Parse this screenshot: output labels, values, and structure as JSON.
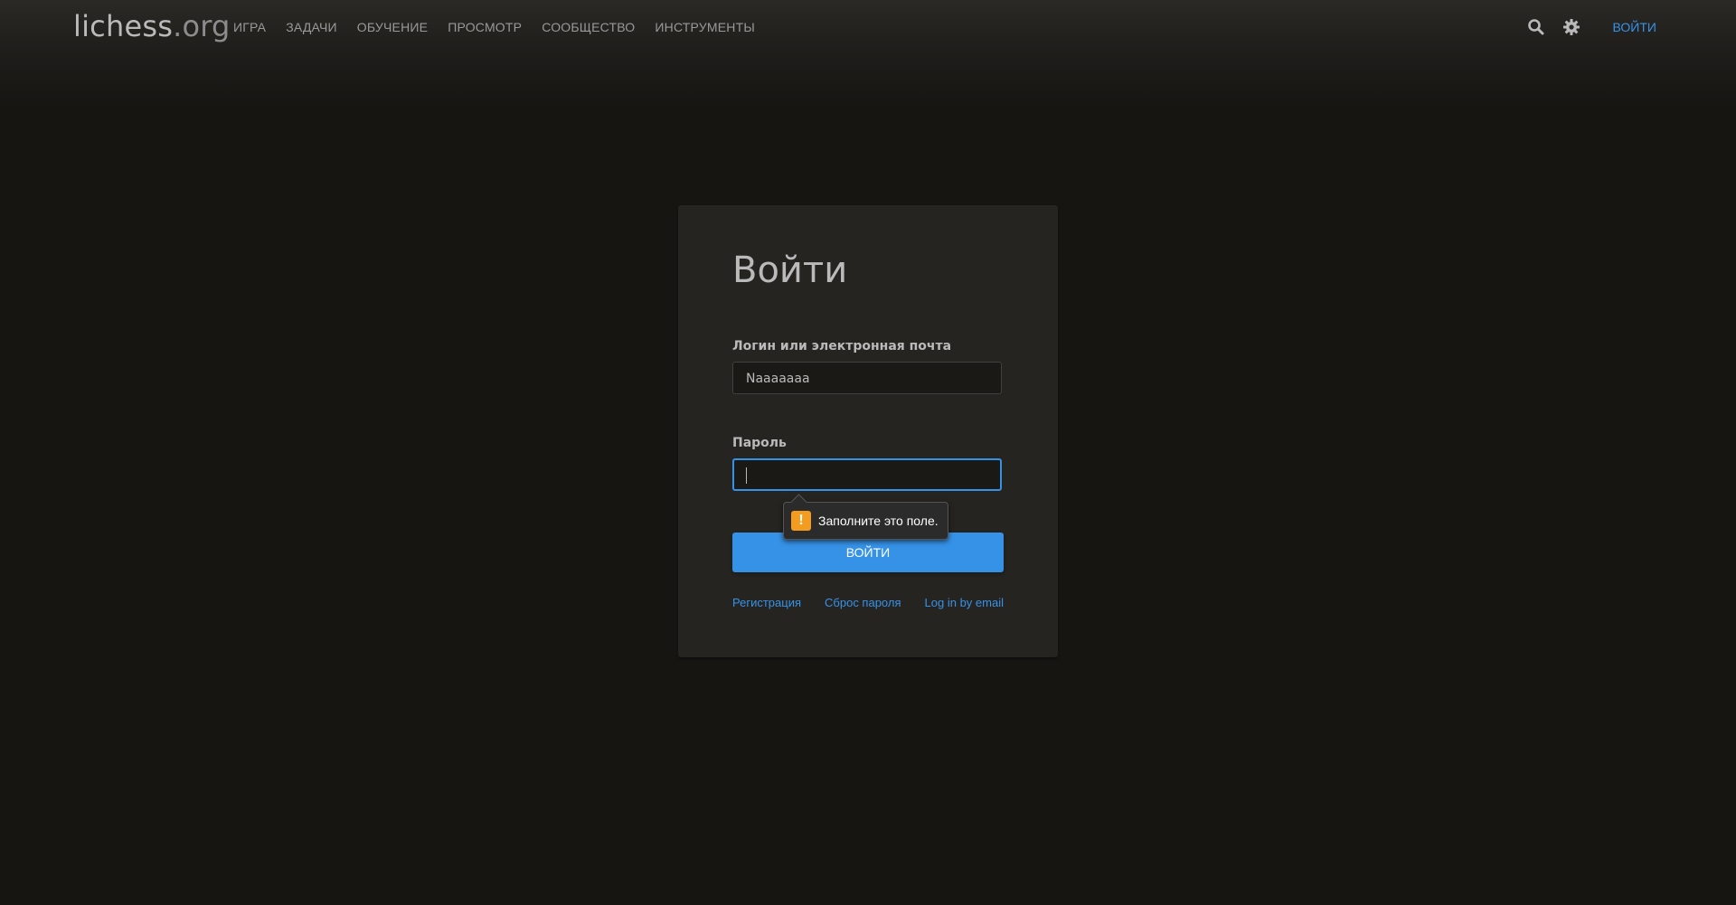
{
  "header": {
    "logo_main": "lichess",
    "logo_tld": ".org",
    "nav": [
      "ИГРА",
      "ЗАДАЧИ",
      "ОБУЧЕНИЕ",
      "ПРОСМОТР",
      "СООБЩЕСТВО",
      "ИНСТРУМЕНТЫ"
    ],
    "signin_label": "ВОЙТИ",
    "icons": [
      "search-icon",
      "gear-icon"
    ]
  },
  "login": {
    "title": "Войти",
    "username_label": "Логин или электронная почта",
    "username_value": "Naaaaaaa",
    "password_label": "Пароль",
    "password_value": "",
    "submit_label": "ВОЙТИ",
    "links": [
      "Регистрация",
      "Сброс пароля",
      "Log in by email"
    ]
  },
  "validation": {
    "message": "Заполните это поле.",
    "icon": "warning-icon"
  },
  "colors": {
    "background": "#161512",
    "card": "#262421",
    "accent": "#3692e7",
    "warning": "#f39c1f"
  }
}
